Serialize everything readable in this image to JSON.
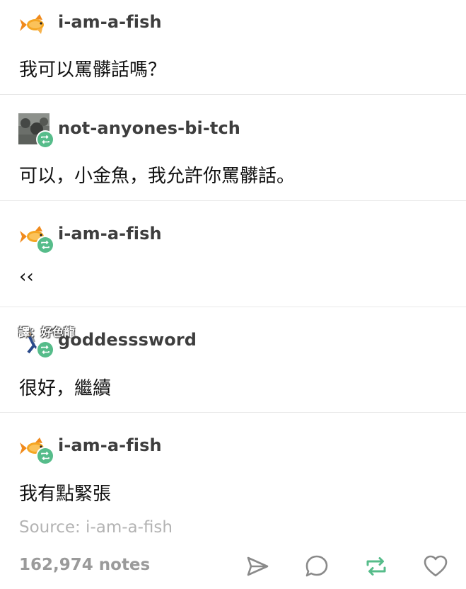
{
  "posts": [
    {
      "username": "i-am-a-fish",
      "message": "我可以罵髒話嗎？"
    },
    {
      "username": "not-anyones-bi-tch",
      "message": "可以，小金魚，我允許你罵髒話。"
    },
    {
      "username": "i-am-a-fish",
      "message": "‹‹"
    },
    {
      "username": "goddesssword",
      "message": "很好，繼續"
    },
    {
      "username": "i-am-a-fish",
      "message": "我有點緊張"
    }
  ],
  "watermark": "譯：好色龍",
  "source": "Source: i-am-a-fish",
  "notes": "162,974 notes",
  "icons": {
    "fish_avatar": "goldfish-icon",
    "reblog_badge": "reblog-icon",
    "share": "send-icon",
    "reply": "comment-icon",
    "reblog": "reblog-icon",
    "like": "heart-icon"
  },
  "colors": {
    "reblog_green": "#56bc8a",
    "goldfish_orange": "#f5a623"
  }
}
